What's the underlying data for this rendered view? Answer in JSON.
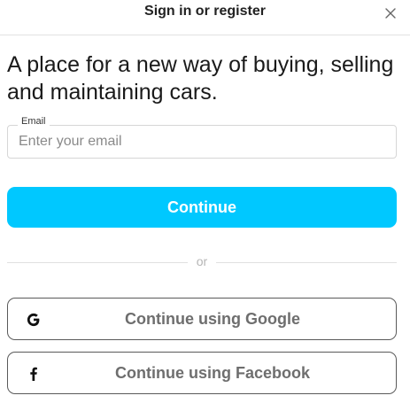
{
  "header": {
    "title": "Sign in or register",
    "close_icon": "close-icon"
  },
  "main": {
    "headline": "A place for a new way of buying, selling and maintaining cars.",
    "email": {
      "label": "Email",
      "placeholder": "Enter your email",
      "value": ""
    },
    "continue_label": "Continue",
    "divider_text": "or",
    "google": {
      "label": "Continue using Google",
      "icon": "google-icon"
    },
    "facebook": {
      "label": "Continue using Facebook",
      "icon": "facebook-icon"
    }
  },
  "colors": {
    "accent": "#00c8ff",
    "button_text": "#ffffff",
    "social_text": "#6e6e6e",
    "border": "#5a5a5a"
  }
}
